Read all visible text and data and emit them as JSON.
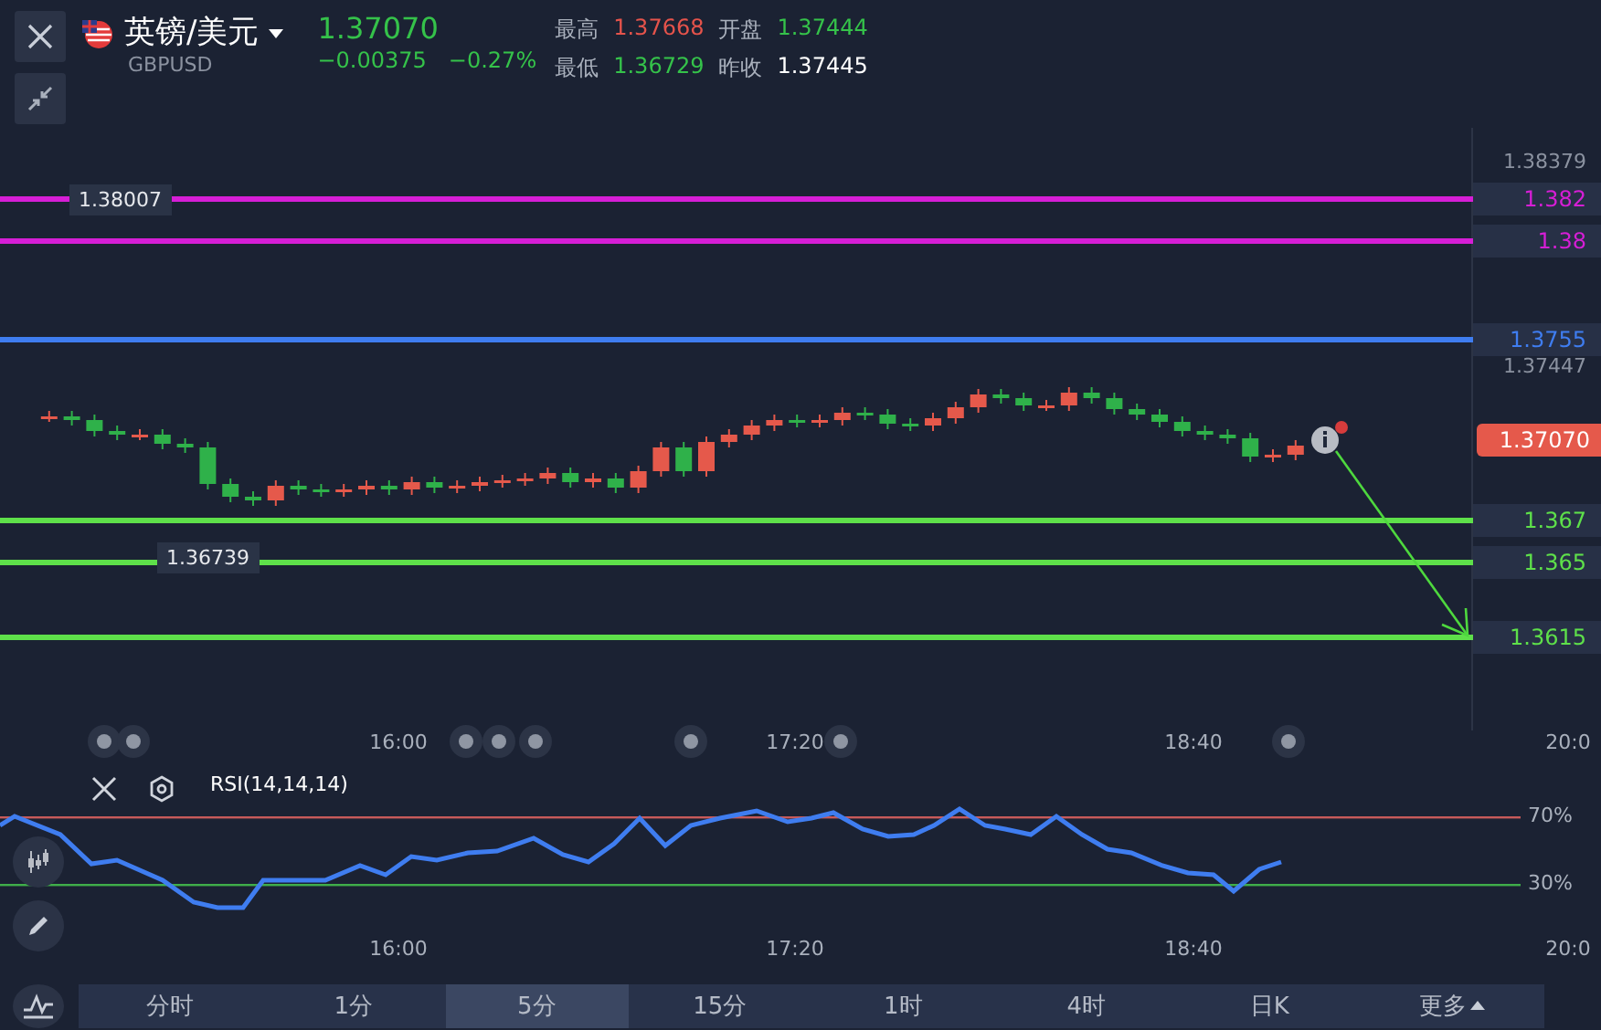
{
  "header": {
    "symbol": {
      "name": "英镑/美元",
      "code": "GBPUSD"
    },
    "price": "1.37070",
    "change": "−0.00375",
    "change_pct": "−0.27%",
    "stats": [
      {
        "label": "最高",
        "value": "1.37668",
        "color": "#e5534b"
      },
      {
        "label": "开盘",
        "value": "1.37444",
        "color": "#35c24a"
      },
      {
        "label": "最低",
        "value": "1.36729",
        "color": "#35c24a"
      },
      {
        "label": "昨收",
        "value": "1.37445",
        "color": "#ffffff"
      }
    ]
  },
  "chart": {
    "axis_ticks": [
      "1.38379",
      "1.37447"
    ],
    "lines": [
      {
        "label": "1.382",
        "color": "#d61ed6"
      },
      {
        "label": "1.38",
        "color": "#d61ed6"
      },
      {
        "label": "1.3755",
        "color": "#3f7df0"
      },
      {
        "label": "1.367",
        "color": "#5ee04a"
      },
      {
        "label": "1.365",
        "color": "#5ee04a"
      },
      {
        "label": "1.3615",
        "color": "#5ee04a"
      }
    ],
    "current_price": "1.37070",
    "extremes": [
      "1.38007",
      "1.36739"
    ],
    "time_axis": [
      "16:00",
      "17:20",
      "18:40",
      "20:0"
    ]
  },
  "rsi": {
    "label": "RSI(14,14,14)",
    "levels": [
      {
        "label": "70%",
        "color": "#c85a5a"
      },
      {
        "label": "30%",
        "color": "#3fae4a"
      }
    ],
    "time_axis": [
      "16:00",
      "17:20",
      "18:40",
      "20:0"
    ]
  },
  "timeframes": [
    {
      "label": "分时",
      "selected": false
    },
    {
      "label": "1分",
      "selected": false
    },
    {
      "label": "5分",
      "selected": true
    },
    {
      "label": "15分",
      "selected": false
    },
    {
      "label": "1时",
      "selected": false
    },
    {
      "label": "4时",
      "selected": false
    },
    {
      "label": "日K",
      "selected": false
    },
    {
      "label": "更多",
      "selected": false
    }
  ]
}
